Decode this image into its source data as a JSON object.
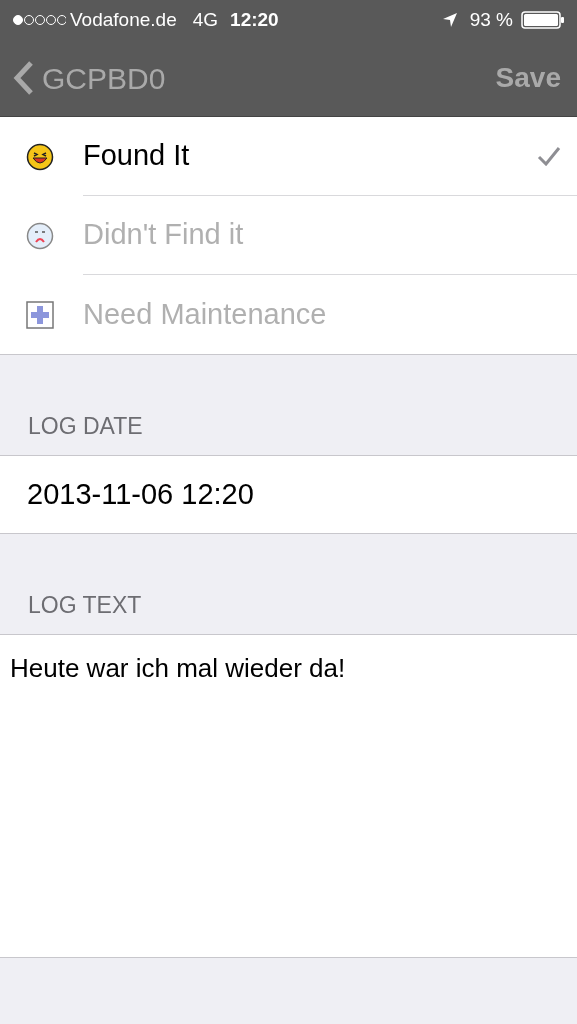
{
  "status_bar": {
    "carrier": "Vodafone.de",
    "network": "4G",
    "time": "12:20",
    "battery": "93 %"
  },
  "nav": {
    "back": "GCPBD0",
    "action": "Save"
  },
  "log_types": [
    {
      "kind": "found",
      "label": "Found It",
      "selected": true
    },
    {
      "kind": "not_found",
      "label": "Didn't Find it",
      "selected": false
    },
    {
      "kind": "maintenance",
      "label": "Need Maintenance",
      "selected": false
    }
  ],
  "log_date": {
    "header": "LOG DATE",
    "value": "2013-11-06 12:20"
  },
  "log_text": {
    "header": "LOG TEXT",
    "value": "Heute war ich mal wieder da!"
  }
}
